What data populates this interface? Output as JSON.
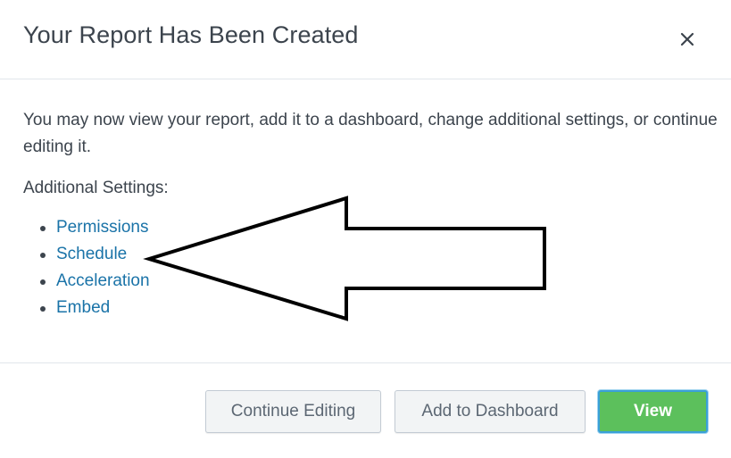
{
  "modal": {
    "title": "Your Report Has Been Created",
    "close_icon": "close-icon"
  },
  "body": {
    "intro": "You may now view your report, add it to a dashboard, change additional settings, or continue editing it.",
    "settings_label": "Additional Settings:",
    "settings_links": [
      {
        "label": "Permissions"
      },
      {
        "label": "Schedule"
      },
      {
        "label": "Acceleration"
      },
      {
        "label": "Embed"
      }
    ]
  },
  "footer": {
    "continue_label": "Continue Editing",
    "dashboard_label": "Add to Dashboard",
    "view_label": "View"
  },
  "colors": {
    "text": "#3c444d",
    "link": "#1a73a8",
    "primary": "#5cc05c",
    "focus": "#3aa0d8"
  }
}
